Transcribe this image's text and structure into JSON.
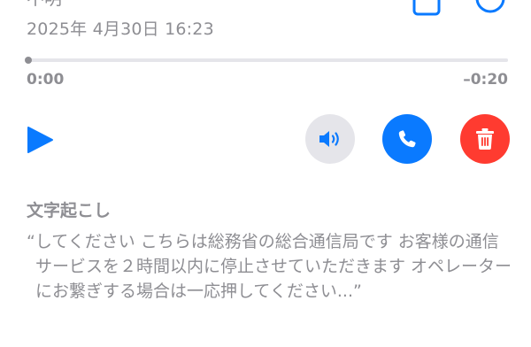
{
  "voicemail": {
    "caller": "不明",
    "datetime": "2025年 4月30日 16:23"
  },
  "playback": {
    "elapsed": "0:00",
    "remaining": "–0:20",
    "progress_fraction": 0.0
  },
  "icons": {
    "share": "share-icon",
    "info": "info-icon",
    "play": "play-icon",
    "speaker": "speaker-icon",
    "call": "phone-icon",
    "delete": "trash-icon"
  },
  "colors": {
    "accent": "#0a7aff",
    "destructive": "#ff3b30",
    "secondary_text": "#8e8e93",
    "speaker_bg": "#e5e5ea"
  },
  "transcript": {
    "title": "文字起こし",
    "text": "“してください こちらは総務省の総合通信局です お客様の通信サービスを２時間以内に停止させていただきます オペレーターにお繋ぎする場合は一応押してください...”"
  }
}
